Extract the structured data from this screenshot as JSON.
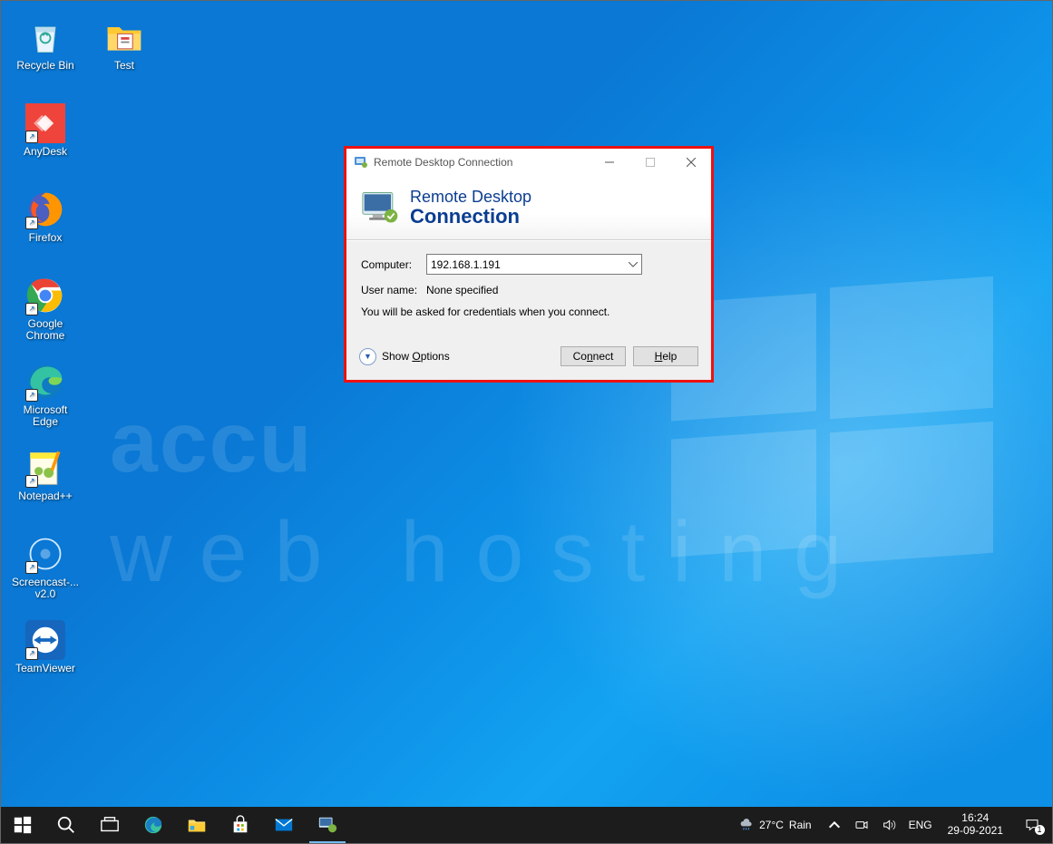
{
  "desktop": {
    "icons": [
      {
        "label": "Recycle Bin"
      },
      {
        "label": "AnyDesk"
      },
      {
        "label": "Firefox"
      },
      {
        "label": "Google Chrome"
      },
      {
        "label": "Microsoft Edge"
      },
      {
        "label": "Notepad++"
      },
      {
        "label": "Screencast-...\nv2.0"
      },
      {
        "label": "TeamViewer"
      }
    ],
    "icon_test": {
      "label": "Test"
    }
  },
  "watermark": {
    "l1": "accu",
    "l2": "web hosting"
  },
  "rdc": {
    "window_title": "Remote Desktop Connection",
    "banner_l1": "Remote Desktop",
    "banner_l2": "Connection",
    "computer_lbl": "Computer:",
    "computer_value": "192.168.1.191",
    "username_lbl": "User name:",
    "username_value": "None specified",
    "hint": "You will be asked for credentials when you connect.",
    "show_options_lbl": "Show Options",
    "connect_lbl": "Connect",
    "help_lbl": "Help"
  },
  "taskbar": {
    "weather_temp": "27°C",
    "weather_cond": "Rain",
    "lang": "ENG",
    "time": "16:24",
    "date": "29-09-2021",
    "notif_count": "1"
  }
}
